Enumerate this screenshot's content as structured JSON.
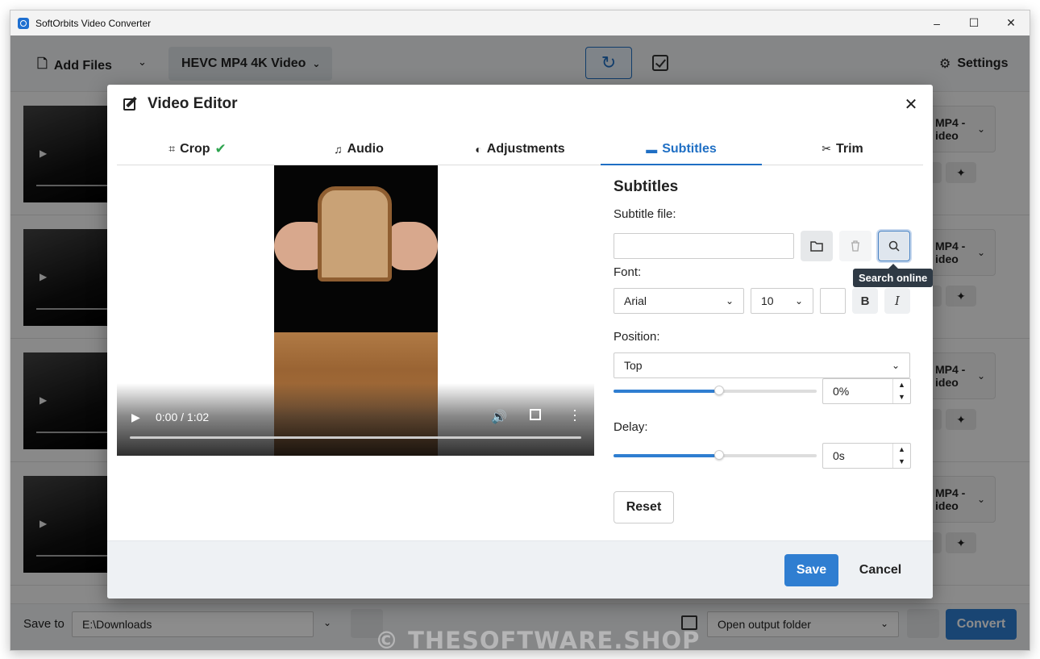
{
  "window": {
    "title": "SoftOrbits Video Converter",
    "controls": {
      "minimize": "–",
      "maximize": "☐",
      "close": "✕"
    }
  },
  "toolbar": {
    "add_files_label": "Add Files",
    "format_label": "HEVC MP4 4K Video",
    "settings_label": "Settings"
  },
  "file_rows": [
    {
      "format": "MP4 -",
      "format_sub": "ideo"
    },
    {
      "format": "MP4 -",
      "format_sub": "ideo"
    },
    {
      "format": "MP4 -",
      "format_sub": "ideo"
    },
    {
      "format": "MP4 -",
      "format_sub": "ideo"
    }
  ],
  "bottom": {
    "save_to_label": "Save to",
    "save_path": "E:\\Downloads",
    "after_action": "Open output folder",
    "convert_label": "Convert"
  },
  "editor": {
    "title": "Video Editor",
    "tabs": [
      {
        "label": "Crop",
        "icon": "crop-icon",
        "done": true
      },
      {
        "label": "Audio",
        "icon": "music-icon"
      },
      {
        "label": "Adjustments",
        "icon": "contrast-icon"
      },
      {
        "label": "Subtitles",
        "icon": "subtitles-icon",
        "active": true
      },
      {
        "label": "Trim",
        "icon": "scissors-icon"
      }
    ],
    "player": {
      "time": "0:00 / 1:02"
    },
    "subtitles": {
      "heading": "Subtitles",
      "file_label": "Subtitle file:",
      "file_value": "",
      "tooltip": "Search online",
      "font_label": "Font:",
      "font_value": "Arial",
      "size_value": "10",
      "bold_label": "B",
      "italic_label": "I",
      "position_label": "Position:",
      "position_value": "Top",
      "position_percent": "0%",
      "delay_label": "Delay:",
      "delay_value": "0s",
      "reset_label": "Reset"
    },
    "save_label": "Save",
    "cancel_label": "Cancel"
  },
  "watermark": "© THESOFTWARE.SHOP",
  "colors": {
    "accent": "#2f7ed1",
    "active_tab": "#1f6fc4",
    "check": "#2ea44f"
  }
}
